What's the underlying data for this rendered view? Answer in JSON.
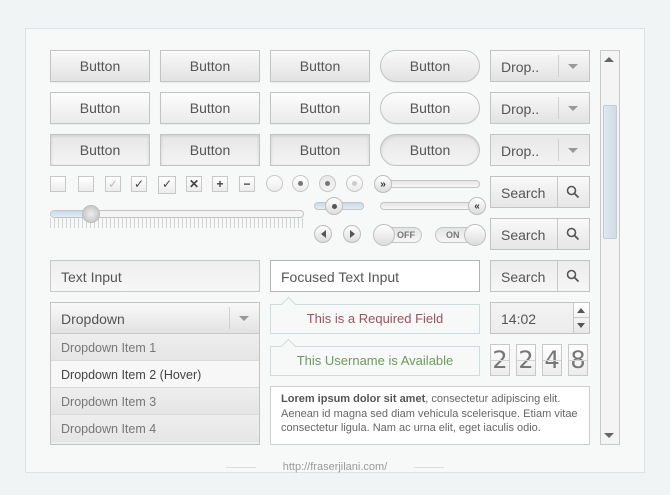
{
  "buttons": {
    "rows": [
      [
        "Button",
        "Button",
        "Button",
        "Button"
      ],
      [
        "Button",
        "Button",
        "Button",
        "Button"
      ],
      [
        "Button",
        "Button",
        "Button",
        "Button"
      ]
    ]
  },
  "dropdowns_small": [
    "Drop..",
    "Drop..",
    "Drop.."
  ],
  "checkboxes": [
    "",
    "",
    "✓",
    "✓",
    "✓",
    "✕",
    "+",
    "−"
  ],
  "slider": {
    "value": 0.16
  },
  "toggles": {
    "off_label": "OFF",
    "on_label": "ON"
  },
  "search": {
    "label": "Search"
  },
  "inputs": {
    "text_input": "Text Input",
    "focused_input": "Focused Text Input"
  },
  "dropdown": {
    "label": "Dropdown",
    "items": [
      "Dropdown Item 1",
      "Dropdown Item 2 (Hover)",
      "Dropdown Item 3",
      "Dropdown Item 4"
    ]
  },
  "tooltips": {
    "required": "This is a Required Field",
    "available": "This Username is Available"
  },
  "required_color": "#a0505a",
  "available_color": "#6c9a5c",
  "time": "14:02",
  "digits": [
    "2",
    "2",
    "4",
    "8"
  ],
  "paragraph": {
    "bold": "Lorem ipsum dolor sit amet",
    "rest": ", consectetur adipiscing elit. Aenean id magna sed diam vehicula scelerisque. Etiam vitae consectetur ligula. Nam ac urna elit, eget iaculis odio."
  },
  "footer_url": "http://fraserjilani.com/"
}
